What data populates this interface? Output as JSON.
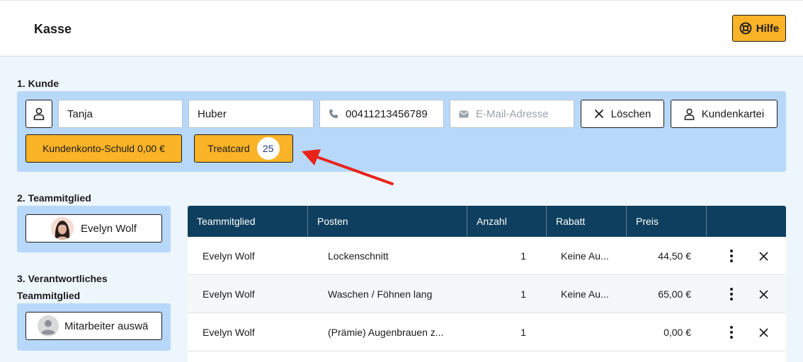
{
  "header": {
    "title": "Kasse",
    "help_label": "Hilfe"
  },
  "customer": {
    "section_label": "1. Kunde",
    "first_name": "Tanja",
    "last_name": "Huber",
    "phone": "00411213456789",
    "email_placeholder": "E-Mail-Adresse",
    "clear_label": "Löschen",
    "card_label": "Kundenkartei",
    "debt_label": "Kundenkonto-Schuld 0,00 €",
    "treatcard_label": "Treatcard",
    "treatcard_count": "25"
  },
  "team_member": {
    "section_label": "2. Teammitglied",
    "selected": "Evelyn Wolf"
  },
  "responsible": {
    "section_label_1": "3. Verantwortliches",
    "section_label_2": "Teammitglied",
    "placeholder": "Mitarbeiter auswä"
  },
  "table": {
    "headers": [
      "Teammitglied",
      "Posten",
      "Anzahl",
      "Rabatt",
      "Preis",
      ""
    ],
    "rows": [
      {
        "member": "Evelyn Wolf",
        "item": "Lockenschnitt",
        "qty": "1",
        "discount": "Keine Au...",
        "price": "44,50 €"
      },
      {
        "member": "Evelyn Wolf",
        "item": "Waschen / Föhnen lang",
        "qty": "1",
        "discount": "Keine Au...",
        "price": "65,00 €"
      },
      {
        "member": "Evelyn Wolf",
        "item": "(Prämie) Augenbrauen z...",
        "qty": "1",
        "discount": "",
        "price": "0,00 €"
      }
    ]
  },
  "colors": {
    "accent": "#fbb327",
    "panel": "#b8d8fa",
    "table_header": "#0e3f5e",
    "arrow": "#e8231c"
  }
}
